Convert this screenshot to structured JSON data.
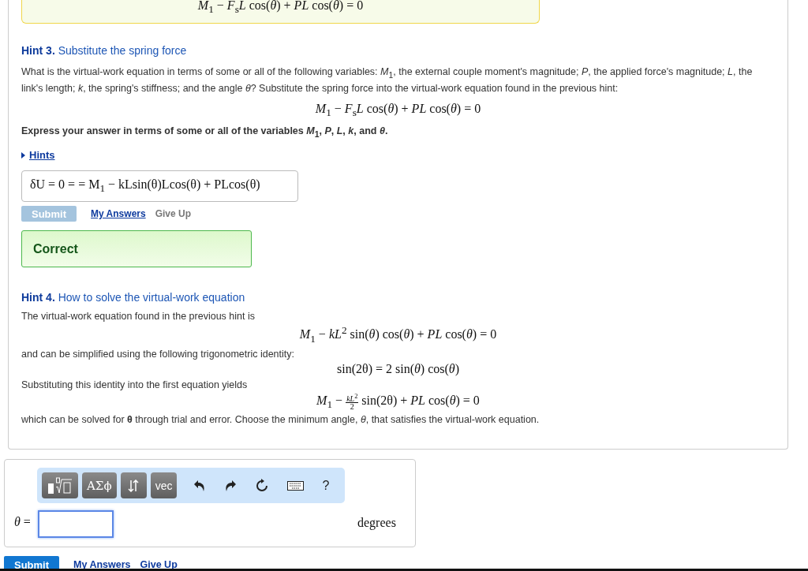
{
  "previous_equation": "*M*$_{1}$ − *F*$_{s}$*L* cos(*θ*) + *PL* cos(*θ*) = 0",
  "hint3": {
    "number": "Hint 3.",
    "title": "Substitute the spring force",
    "question": "What is the virtual-work equation in terms of some or all of the following variables: *M*$_{1}$, the external couple moment's magnitude; *P*, the applied force's magnitude; *L*, the link's length; *k*, the spring's stiffness; and the angle *θ*? Substitute the spring force into the virtual-work equation found in the previous hint:",
    "equation": "*M*$_{1}$ − *F*$_{s}$*L* cos(*θ*) + *PL* cos(*θ*) = 0",
    "instruction": "Express your answer in terms of some or all of the variables *M*$_{1}$, *P*, *L*, *k*, and *θ*.",
    "hints_link": "Hints",
    "answer": "δU = 0 = = M$_{1}$ − kLsin(θ)Lcos(θ) + PLcos(θ)",
    "submit": {
      "label": "Submit",
      "disabled": true
    },
    "my_answers": "My Answers",
    "give_up": {
      "label": "Give Up",
      "disabled": true
    },
    "feedback": "Correct"
  },
  "hint4": {
    "number": "Hint 4.",
    "title": "How to solve the virtual-work equation",
    "blocks": [
      {
        "kind": "text",
        "text": "The virtual-work equation found in the previous hint is"
      },
      {
        "kind": "equation",
        "text": "*M*$_{1}$ − *kL*$^{2}$ sin(*θ*) cos(*θ*) + *PL* cos(*θ*) = 0"
      },
      {
        "kind": "text",
        "text": "and can be simplified using the following trigonometric identity:"
      },
      {
        "kind": "equation",
        "text": "sin(2θ) = 2 sin(*θ*) cos(*θ*)"
      },
      {
        "kind": "text",
        "text": "Substituting this identity into the first equation yields"
      },
      {
        "kind": "fraction_equation",
        "before": "*M*$_{1}$ −",
        "numerator": "*kL*$^{2}$",
        "denominator": "2",
        "after": "sin(2θ) + *PL* cos(*θ*) = 0"
      },
      {
        "kind": "text",
        "text": "which can be solved for **θ** through trial and error. Choose the minimum angle, *θ*, that satisfies the virtual-work equation."
      }
    ]
  },
  "answer_panel": {
    "symbols_label": "ΑΣϕ",
    "vector_label": "vec",
    "help_label": "?",
    "variable": "*θ* =",
    "units": "degrees"
  },
  "actions": {
    "submit": {
      "label": "Submit",
      "disabled": false
    },
    "my_answers": "My Answers",
    "give_up": {
      "label": "Give Up",
      "disabled": false
    }
  }
}
